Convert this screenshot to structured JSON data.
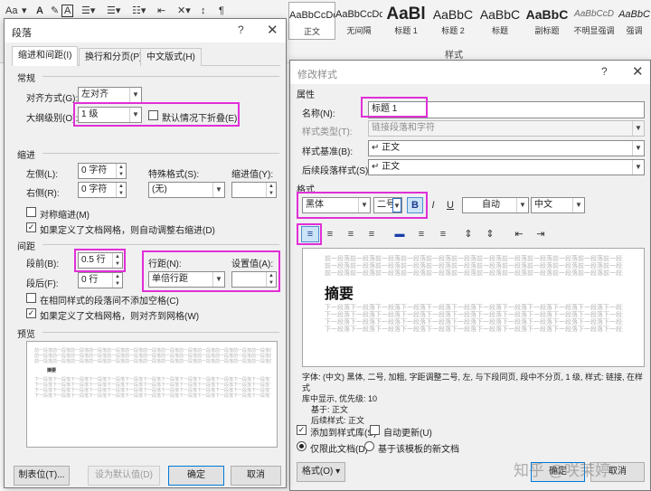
{
  "ribbon": {
    "font_size_btn": "Aa",
    "styles": [
      {
        "sample": "AaBbCcDc",
        "label": "正文"
      },
      {
        "sample": "AaBbCcDc",
        "label": "无间隔"
      },
      {
        "sample": "AaBl",
        "label": "标题 1"
      },
      {
        "sample": "AaBbC",
        "label": "标题 2"
      },
      {
        "sample": "AaBbC",
        "label": "标题"
      },
      {
        "sample": "AaBbC",
        "label": "副标题"
      },
      {
        "sample": "AaBbCcD",
        "label": "不明显强调"
      },
      {
        "sample": "AaBbC",
        "label": "强调"
      }
    ],
    "group_label": "样式"
  },
  "para": {
    "title": "段落",
    "help": "?",
    "close": "✕",
    "tabs": [
      "缩进和间距(I)",
      "换行和分页(P)",
      "中文版式(H)"
    ],
    "general": {
      "header": "常规",
      "align_label": "对齐方式(G):",
      "align_value": "左对齐",
      "outline_label": "大纲级别(O):",
      "outline_value": "1 级",
      "collapse_label": "默认情况下折叠(E)"
    },
    "indent": {
      "header": "缩进",
      "left_label": "左侧(L):",
      "left_value": "0 字符",
      "right_label": "右侧(R):",
      "right_value": "0 字符",
      "special_label": "特殊格式(S):",
      "special_value": "(无)",
      "by_label": "缩进值(Y):",
      "mirror_label": "对称缩进(M)",
      "auto_right_label": "如果定义了文档网格，则自动调整右缩进(D)"
    },
    "spacing": {
      "header": "间距",
      "before_label": "段前(B):",
      "before_value": "0.5 行",
      "after_label": "段后(F):",
      "after_value": "0 行",
      "line_label": "行距(N):",
      "line_value": "单倍行距",
      "at_label": "设置值(A):",
      "no_space_label": "在相同样式的段落间不添加空格(C)",
      "snap_label": "如果定义了文档网格，则对齐到网格(W)"
    },
    "preview_header": "预览",
    "preview_sample": "摘要",
    "buttons": {
      "tabs": "制表位(T)...",
      "default": "设为默认值(D)",
      "ok": "确定",
      "cancel": "取消"
    }
  },
  "modify": {
    "title": "修改样式",
    "help": "?",
    "close": "✕",
    "props_header": "属性",
    "name_label": "名称(N):",
    "name_value": "标题 1",
    "type_label": "样式类型(T):",
    "type_value": "链接段落和字符",
    "based_label": "样式基准(B):",
    "based_value": "↵ 正文",
    "next_label": "后续段落样式(S):",
    "next_value": "↵ 正文",
    "format_header": "格式",
    "font_value": "黑体",
    "size_value": "二号",
    "bold": "B",
    "italic": "I",
    "underline": "U",
    "color_value": "自动",
    "lang_value": "中文",
    "preview_sample": "摘要",
    "prev_line": "前一段落前一段落前一段落前一段落前一段落前一段落前一段落前一段落前一段落前一段落前一段落前一段落前一段落前一段落",
    "next_line": "下一段落下一段落下一段落下一段落下一段落下一段落下一段落下一段落下一段落下一段落下一段落下一段落下一段落下一段落",
    "desc_lines": [
      "字体: (中文) 黑体, 二号, 加粗, 字距调整二号, 左, 与下段同页, 段中不分页, 1 级, 样式: 链接, 在样式",
      "库中显示, 优先级: 10",
      "    基于: 正文",
      "    后续样式: 正文"
    ],
    "add_gallery_label": "添加到样式库(S)",
    "auto_update_label": "自动更新(U)",
    "only_doc_label": "仅限此文档(D)",
    "new_template_label": "基于该模板的新文档",
    "format_btn": "格式(O) ▾",
    "ok": "确定",
    "cancel": "取消"
  },
  "watermark": "知乎 @咲茉婷",
  "colors": {
    "highlight": "#e02fd7",
    "accent": "#0078d7"
  }
}
